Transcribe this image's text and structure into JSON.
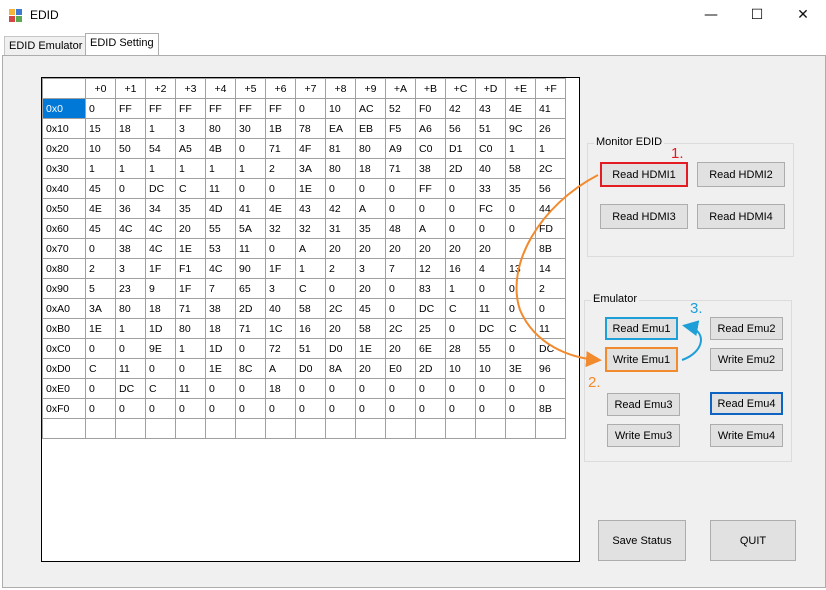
{
  "window": {
    "title": "EDID",
    "minimize_glyph": "—",
    "maximize_glyph": "☐",
    "close_glyph": "✕"
  },
  "tabs": [
    {
      "label": "EDID Emulator",
      "active": false
    },
    {
      "label": "EDID Setting",
      "active": true
    }
  ],
  "grid": {
    "column_headers": [
      "+0",
      "+1",
      "+2",
      "+3",
      "+4",
      "+5",
      "+6",
      "+7",
      "+8",
      "+9",
      "+A",
      "+B",
      "+C",
      "+D",
      "+E",
      "+F"
    ],
    "selected_row": "0x0",
    "rows": [
      {
        "label": "0x0",
        "cells": [
          "0",
          "FF",
          "FF",
          "FF",
          "FF",
          "FF",
          "FF",
          "0",
          "10",
          "AC",
          "52",
          "F0",
          "42",
          "43",
          "4E",
          "41"
        ]
      },
      {
        "label": "0x10",
        "cells": [
          "15",
          "18",
          "1",
          "3",
          "80",
          "30",
          "1B",
          "78",
          "EA",
          "EB",
          "F5",
          "A6",
          "56",
          "51",
          "9C",
          "26"
        ]
      },
      {
        "label": "0x20",
        "cells": [
          "10",
          "50",
          "54",
          "A5",
          "4B",
          "0",
          "71",
          "4F",
          "81",
          "80",
          "A9",
          "C0",
          "D1",
          "C0",
          "1",
          "1"
        ]
      },
      {
        "label": "0x30",
        "cells": [
          "1",
          "1",
          "1",
          "1",
          "1",
          "1",
          "2",
          "3A",
          "80",
          "18",
          "71",
          "38",
          "2D",
          "40",
          "58",
          "2C"
        ]
      },
      {
        "label": "0x40",
        "cells": [
          "45",
          "0",
          "DC",
          "C",
          "11",
          "0",
          "0",
          "1E",
          "0",
          "0",
          "0",
          "FF",
          "0",
          "33",
          "35",
          "56"
        ]
      },
      {
        "label": "0x50",
        "cells": [
          "4E",
          "36",
          "34",
          "35",
          "4D",
          "41",
          "4E",
          "43",
          "42",
          "A",
          "0",
          "0",
          "0",
          "FC",
          "0",
          "44"
        ]
      },
      {
        "label": "0x60",
        "cells": [
          "45",
          "4C",
          "4C",
          "20",
          "55",
          "5A",
          "32",
          "32",
          "31",
          "35",
          "48",
          "A",
          "0",
          "0",
          "0",
          "FD"
        ]
      },
      {
        "label": "0x70",
        "cells": [
          "0",
          "38",
          "4C",
          "1E",
          "53",
          "11",
          "0",
          "A",
          "20",
          "20",
          "20",
          "20",
          "20",
          "20",
          "",
          "8B"
        ]
      },
      {
        "label": "0x80",
        "cells": [
          "2",
          "3",
          "1F",
          "F1",
          "4C",
          "90",
          "1F",
          "1",
          "2",
          "3",
          "7",
          "12",
          "16",
          "4",
          "13",
          "14"
        ]
      },
      {
        "label": "0x90",
        "cells": [
          "5",
          "23",
          "9",
          "1F",
          "7",
          "65",
          "3",
          "C",
          "0",
          "20",
          "0",
          "83",
          "1",
          "0",
          "0",
          "2"
        ]
      },
      {
        "label": "0xA0",
        "cells": [
          "3A",
          "80",
          "18",
          "71",
          "38",
          "2D",
          "40",
          "58",
          "2C",
          "45",
          "0",
          "DC",
          "C",
          "11",
          "0",
          "0"
        ]
      },
      {
        "label": "0xB0",
        "cells": [
          "1E",
          "1",
          "1D",
          "80",
          "18",
          "71",
          "1C",
          "16",
          "20",
          "58",
          "2C",
          "25",
          "0",
          "DC",
          "C",
          "11"
        ]
      },
      {
        "label": "0xC0",
        "cells": [
          "0",
          "0",
          "9E",
          "1",
          "1D",
          "0",
          "72",
          "51",
          "D0",
          "1E",
          "20",
          "6E",
          "28",
          "55",
          "0",
          "DC"
        ]
      },
      {
        "label": "0xD0",
        "cells": [
          "C",
          "11",
          "0",
          "0",
          "1E",
          "8C",
          "A",
          "D0",
          "8A",
          "20",
          "E0",
          "2D",
          "10",
          "10",
          "3E",
          "96"
        ]
      },
      {
        "label": "0xE0",
        "cells": [
          "0",
          "DC",
          "C",
          "11",
          "0",
          "0",
          "18",
          "0",
          "0",
          "0",
          "0",
          "0",
          "0",
          "0",
          "0",
          "0"
        ]
      },
      {
        "label": "0xF0",
        "cells": [
          "0",
          "0",
          "0",
          "0",
          "0",
          "0",
          "0",
          "0",
          "0",
          "0",
          "0",
          "0",
          "0",
          "0",
          "0",
          "8B"
        ]
      }
    ]
  },
  "monitor_edid": {
    "title": "Monitor EDID",
    "read_hdmi1": "Read HDMI1",
    "read_hdmi2": "Read HDMI2",
    "read_hdmi3": "Read HDMI3",
    "read_hdmi4": "Read HDMI4"
  },
  "emulator": {
    "title": "Emulator",
    "read_emu1": "Read Emu1",
    "read_emu2": "Read Emu2",
    "write_emu1": "Write Emu1",
    "write_emu2": "Write Emu2",
    "read_emu3": "Read Emu3",
    "read_emu4": "Read Emu4",
    "write_emu3": "Write Emu3",
    "write_emu4": "Write Emu4"
  },
  "actions": {
    "save_status": "Save Status",
    "quit": "QUIT"
  },
  "annotations": {
    "step1": "1.",
    "step2": "2.",
    "step3": "3.",
    "color_red": "#e31b23",
    "color_orange": "#f28a2e",
    "color_blue": "#1e9fd8"
  }
}
